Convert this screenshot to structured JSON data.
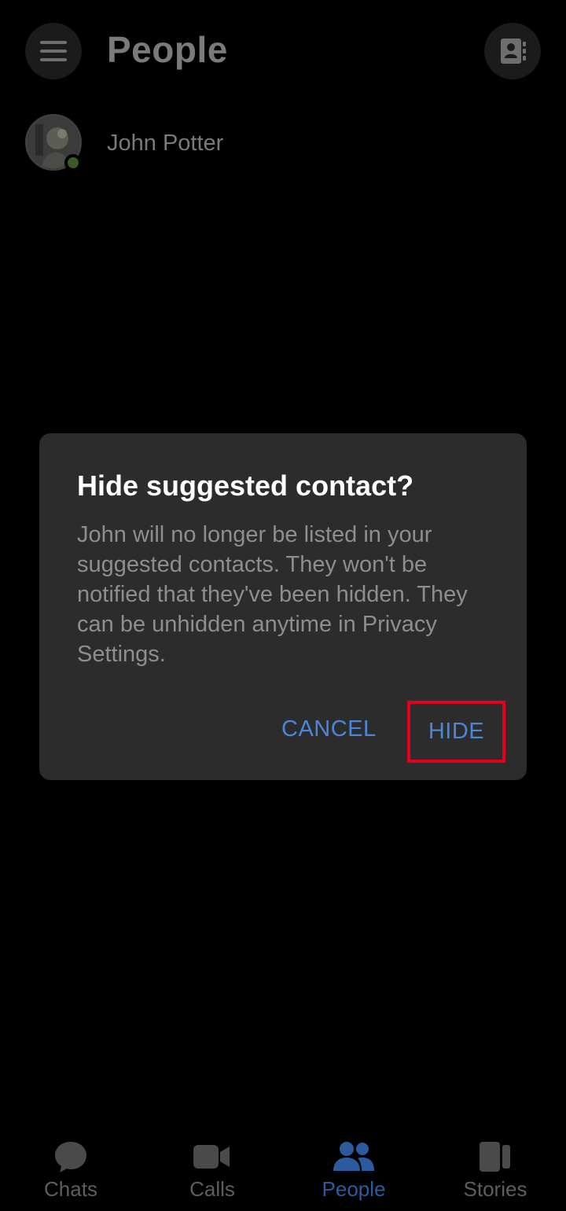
{
  "header": {
    "title": "People",
    "menu_icon": "menu-icon",
    "contacts_icon": "contact-book-icon"
  },
  "contact": {
    "name": "John Potter",
    "presence": "online"
  },
  "dialog": {
    "title": "Hide suggested contact?",
    "body": "John will no longer be listed in your suggested contacts. They won't be notified that they've been hidden. They can be unhidden anytime in Privacy Settings.",
    "cancel_label": "CANCEL",
    "hide_label": "HIDE"
  },
  "bottom_nav": {
    "items": [
      {
        "label": "Chats",
        "icon": "chat-bubble-icon",
        "active": false
      },
      {
        "label": "Calls",
        "icon": "video-camera-icon",
        "active": false
      },
      {
        "label": "People",
        "icon": "people-icon",
        "active": true
      },
      {
        "label": "Stories",
        "icon": "stories-icon",
        "active": false
      }
    ]
  },
  "colors": {
    "accent": "#4a86d9",
    "highlight": "#e3001b",
    "dialog_bg": "#2c2c2c",
    "background": "#000000"
  }
}
